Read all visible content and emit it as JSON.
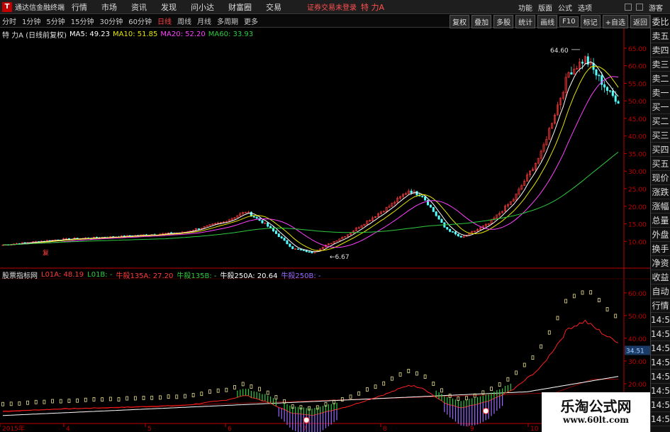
{
  "app": {
    "title": "通达信金融终端",
    "logo_text": "T",
    "menu": [
      "行情",
      "市场",
      "资讯",
      "发现",
      "问小达",
      "财富圈",
      "交易"
    ],
    "login_status": "证券交易未登录",
    "stock_title": "特 力A",
    "right_menu": [
      "功能",
      "版面",
      "公式",
      "选项"
    ],
    "guest_label": "游客"
  },
  "periods": {
    "items": [
      "分时",
      "1分钟",
      "5分钟",
      "15分钟",
      "30分钟",
      "60分钟",
      "日线",
      "周线",
      "月线",
      "多周期",
      "更多"
    ],
    "active": "日线"
  },
  "toolbar": [
    "复权",
    "叠加",
    "多股",
    "统计",
    "画线",
    "F10",
    "标记",
    "+自选",
    "返回"
  ],
  "ma_legend": {
    "stock": "特 力A (日线前复权)",
    "ma5": "MA5: 49.23",
    "ma10": "MA10: 51.85",
    "ma20": "MA20: 52.20",
    "ma60": "MA60: 33.93"
  },
  "indicator_legend": {
    "name": "股票指标网",
    "l01a": "L01A: 48.19",
    "l01b": "L01B: -",
    "n135a": "牛殺135A: 27.20",
    "n135b": "牛殺135B: -",
    "n250a": "牛殺250A: 20.64",
    "n250b": "牛殺250B: -"
  },
  "colors": {
    "up": "#ff3b3b",
    "down": "#54ffff",
    "ma5": "#ffffff",
    "ma10": "#e6e600",
    "ma20": "#ff40ff",
    "ma60": "#2ecc40",
    "axis": "#c00000"
  },
  "price_axis": [
    "65.00",
    "60.00",
    "55.00",
    "50.00",
    "45.00",
    "40.00",
    "35.00",
    "30.00",
    "25.00",
    "20.00",
    "15.00",
    "10.00"
  ],
  "ind_axis": [
    "60.00",
    "50.00",
    "40.00",
    "30.00",
    "20.00"
  ],
  "ind_current_value": "34.51",
  "time_axis": [
    "2015年",
    "4",
    "5",
    "6",
    "7",
    "8",
    "9",
    "10"
  ],
  "annotations": {
    "high": "64.60",
    "low": "6.67",
    "event_tag": "复"
  },
  "side_panel": {
    "indicator": "L",
    "items": [
      "委比",
      "卖五",
      "卖四",
      "卖三",
      "卖二",
      "卖一",
      "买一",
      "买二",
      "买三",
      "买四",
      "买五",
      "现价",
      "涨跌",
      "涨幅",
      "总量",
      "外盘",
      "换手",
      "净资",
      "收益",
      "自动",
      "行情",
      "14:50",
      "14:50",
      "14:50",
      "14:50",
      "14:50",
      "14:50",
      "14:50",
      "14:50"
    ]
  },
  "watermark": {
    "main": "乐淘公式网",
    "url": "www.60lt.com"
  }
}
